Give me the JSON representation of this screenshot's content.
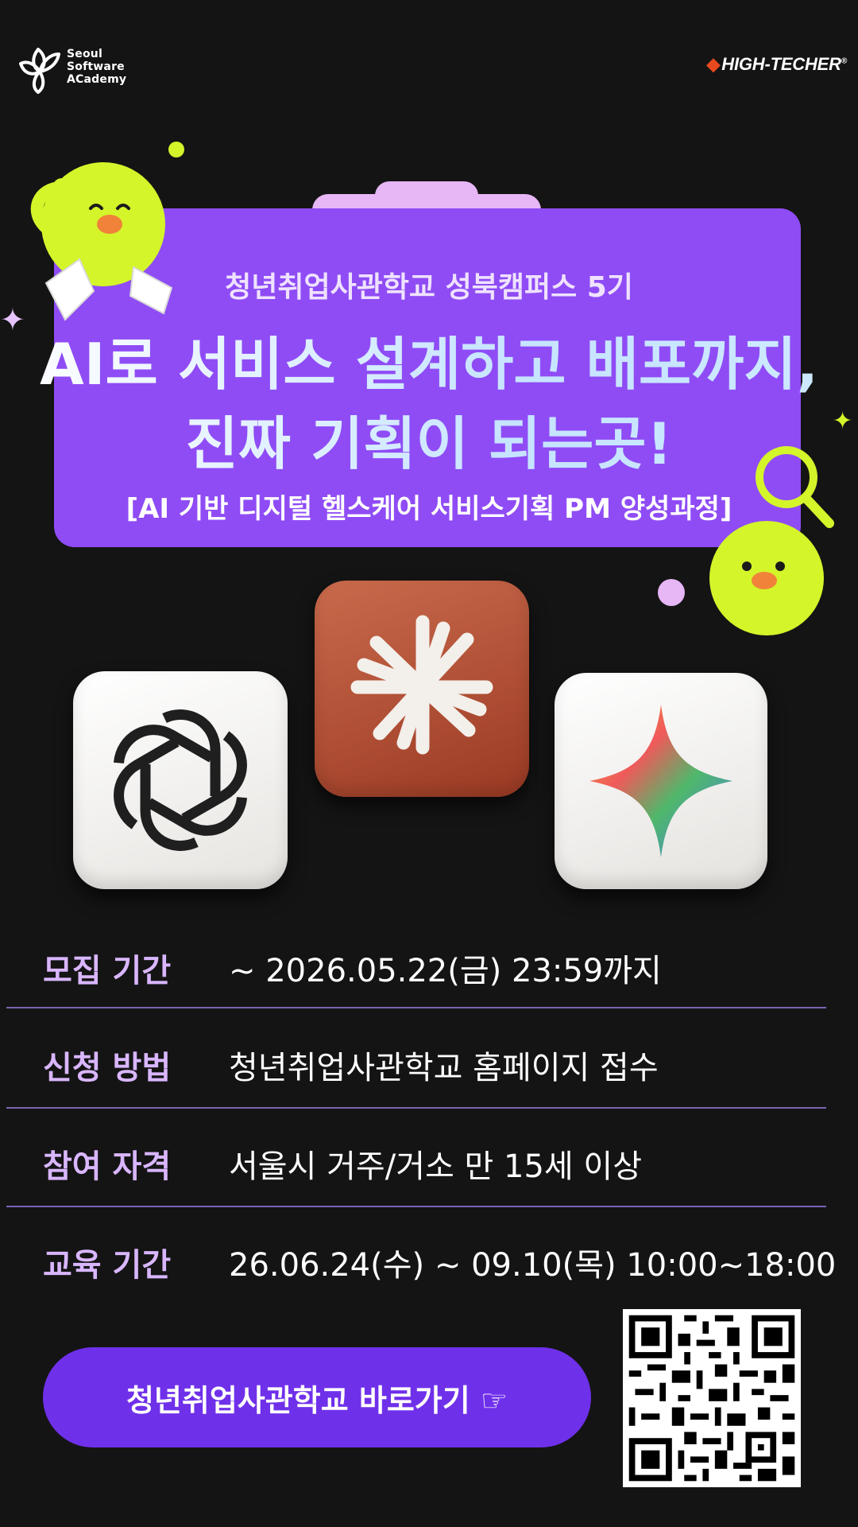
{
  "header": {
    "ssa_logo_lines": [
      "Seoul",
      "Software",
      "ACademy"
    ],
    "hightecher_logo": "HIGH-TECHER",
    "hightecher_mark": "®"
  },
  "hero": {
    "subtitle": "청년취업사관학교 성북캠퍼스 5기",
    "title_line1": "AI로 서비스 설계하고 배포까지,",
    "title_line2": "진짜 기획이 되는곳!",
    "course": "[AI 기반 디지털 헬스케어 서비스기획 PM 양성과정]"
  },
  "icons": [
    "openai-icon",
    "claude-icon",
    "gemini-icon"
  ],
  "info": [
    {
      "label": "모집 기간",
      "value": "~ 2026.05.22(금) 23:59까지"
    },
    {
      "label": "신청 방법",
      "value": "청년취업사관학교 홈페이지 접수"
    },
    {
      "label": "참여 자격",
      "value": "서울시 거주/거소 만 15세 이상"
    },
    {
      "label": "교육 기간",
      "value": "26.06.24(수) ~ 09.10(목) 10:00~18:00"
    }
  ],
  "cta": {
    "label": "청년취업사관학교 바로가기 ☞"
  },
  "colors": {
    "background": "#141414",
    "card": "#8f4cf5",
    "card_tab": "#e6b6f5",
    "label": "#d9b6ff",
    "cta": "#6f30ea",
    "character": "#d4f52a"
  }
}
